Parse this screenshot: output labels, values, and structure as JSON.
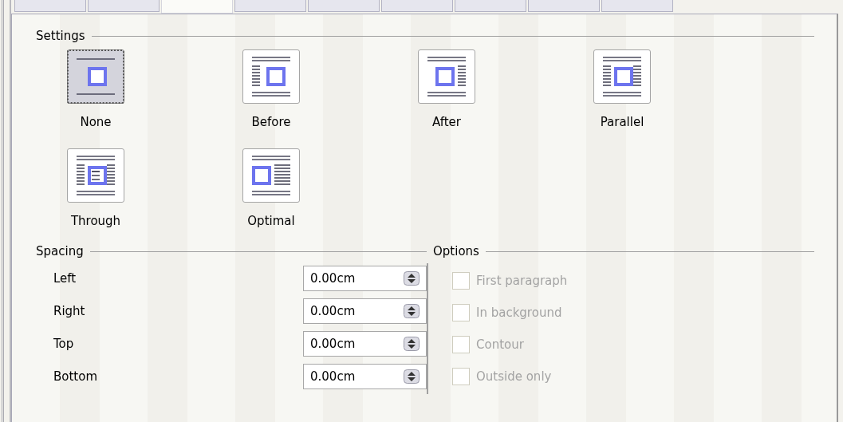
{
  "tabs": [
    {
      "selected": false
    },
    {
      "selected": false
    },
    {
      "selected": true
    },
    {
      "selected": false
    },
    {
      "selected": false
    },
    {
      "selected": false
    },
    {
      "selected": false
    },
    {
      "selected": false
    },
    {
      "selected": false
    }
  ],
  "settings": {
    "title": "Settings",
    "options": [
      {
        "kind": "none",
        "label": "None",
        "selected": true
      },
      {
        "kind": "before",
        "label": "Before",
        "selected": false
      },
      {
        "kind": "after",
        "label": "After",
        "selected": false
      },
      {
        "kind": "parallel",
        "label": "Parallel",
        "selected": false
      },
      {
        "kind": "through",
        "label": "Through",
        "selected": false
      },
      {
        "kind": "optimal",
        "label": "Optimal",
        "selected": false
      }
    ]
  },
  "spacing": {
    "title": "Spacing",
    "fields": [
      {
        "label": "Left",
        "value": "0.00cm"
      },
      {
        "label": "Right",
        "value": "0.00cm"
      },
      {
        "label": "Top",
        "value": "0.00cm"
      },
      {
        "label": "Bottom",
        "value": "0.00cm"
      }
    ]
  },
  "options": {
    "title": "Options",
    "items": [
      {
        "label": "First paragraph",
        "checked": false,
        "disabled": true
      },
      {
        "label": "In background",
        "checked": false,
        "disabled": true
      },
      {
        "label": "Contour",
        "checked": false,
        "disabled": true
      },
      {
        "label": "Outside only",
        "checked": false,
        "disabled": true
      }
    ]
  }
}
